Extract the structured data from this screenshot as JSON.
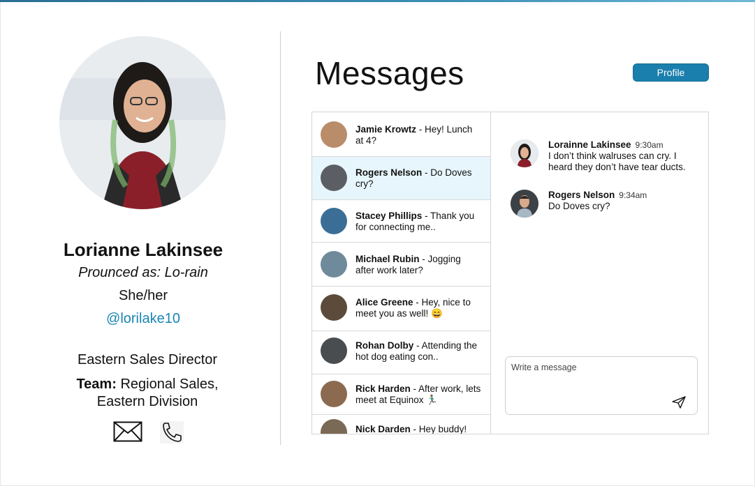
{
  "profile": {
    "name": "Lorianne Lakinsee",
    "pronunciation": "Prounced as: Lo-rain",
    "pronouns": "She/her",
    "handle": "@lorilake10",
    "role": "Eastern Sales Director",
    "team_label": "Team:",
    "team_value_line1": "Regional Sales,",
    "team_value_line2": "Eastern Division",
    "icons": [
      "mail-icon",
      "phone-icon"
    ]
  },
  "header": {
    "title": "Messages",
    "profile_button": "Profile"
  },
  "conversations": [
    {
      "name": "Jamie Krowtz",
      "preview": " - Hey! Lunch at 4?",
      "avatar_color": "#b98c6a"
    },
    {
      "name": "Rogers Nelson",
      "preview": " - Do Doves cry?",
      "avatar_color": "#5b5f63",
      "selected": true
    },
    {
      "name": "Stacey Phillips",
      "preview": " - Thank you for connecting me..",
      "avatar_color": "#3a6e96"
    },
    {
      "name": "Michael Rubin",
      "preview": " - Jogging after work later?",
      "avatar_color": "#6f8a9a"
    },
    {
      "name": "Alice Greene",
      "preview": " - Hey, nice to meet you as well! 😄",
      "avatar_color": "#5c4a3a"
    },
    {
      "name": "Rohan Dolby",
      "preview": " - Attending the hot dog eating con..",
      "avatar_color": "#4a4d50"
    },
    {
      "name": "Rick Harden",
      "preview": " - After work, lets meet at Equinox 🏃🏽‍♂️",
      "avatar_color": "#8b6a4f"
    },
    {
      "name": "Nick Darden",
      "preview": " - Hey buddy!",
      "avatar_color": "#7a6a55"
    }
  ],
  "thread": [
    {
      "sender": "Lorainne Lakinsee",
      "time": "9:30am",
      "text": "I don’t think walruses can cry. I heard they don’t have tear ducts."
    },
    {
      "sender": "Rogers Nelson",
      "time": "9:34am",
      "text": "Do Doves cry?"
    }
  ],
  "compose": {
    "placeholder": "Write a message"
  },
  "colors": {
    "accent": "#1a7fac",
    "handle": "#1a86b3",
    "selected_row": "#e6f6fc"
  }
}
